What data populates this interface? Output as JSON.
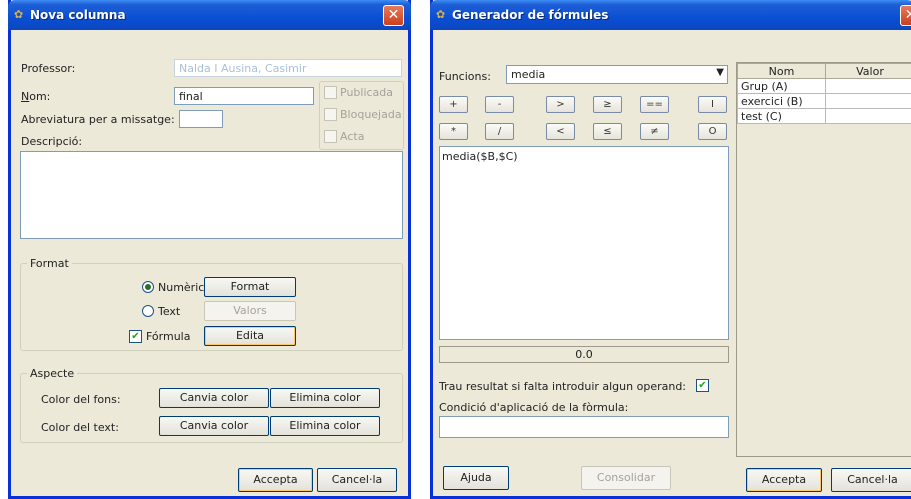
{
  "colors": {
    "titlebar": "#0a4fd3",
    "window_bg": "#ece9d8",
    "close": "#c8401c"
  },
  "left_window": {
    "title": "Nova columna",
    "professor_label": "Professor:",
    "professor_value": "Nalda I Ausina, Casimir",
    "nom_label": "Nom:",
    "nom_value": "final",
    "abrev_label": "Abreviatura per a missatge:",
    "abrev_value": "",
    "descripcio_label": "Descripció:",
    "publicada_label": "Publicada",
    "bloquejada_label": "Bloquejada",
    "acta_label": "Acta",
    "format_group": "Format",
    "numeric_label": "Numèric",
    "format_button": "Format",
    "text_label": "Text",
    "valors_button": "Valors",
    "formula_label": "Fórmula",
    "edita_button": "Edita",
    "aspecte_group": "Aspecte",
    "color_fons_label": "Color del fons:",
    "color_text_label": "Color del text:",
    "canvia_color_1": "Canvia color",
    "elimina_color_1": "Elimina color",
    "canvia_color_2": "Canvia color",
    "elimina_color_2": "Elimina color",
    "accepta": "Accepta",
    "cancella": "Cancel·la"
  },
  "right_window": {
    "title": "Generador de fórmules",
    "funcions_label": "Funcions:",
    "funcions_value": "media",
    "operators_row1": [
      "+",
      "-",
      ">",
      "≥",
      "==",
      "I"
    ],
    "operators_row2": [
      "*",
      "/",
      "<",
      "≤",
      "≠",
      "O"
    ],
    "formula_text": "media($B,$C)",
    "result": "0.0",
    "trau_label": "Trau resultat si falta introduir algun operand:",
    "condicio_label": "Condició d'aplicació de la fòrmula:",
    "condicio_value": "",
    "table_headers": [
      "Nom",
      "Valor"
    ],
    "table_rows": [
      {
        "nom": "Grup (A)",
        "valor": ""
      },
      {
        "nom": "exercici (B)",
        "valor": ""
      },
      {
        "nom": "test (C)",
        "valor": ""
      }
    ],
    "ajuda": "Ajuda",
    "consolidar": "Consolidar",
    "accepta": "Accepta",
    "cancella": "Cancel·la"
  }
}
